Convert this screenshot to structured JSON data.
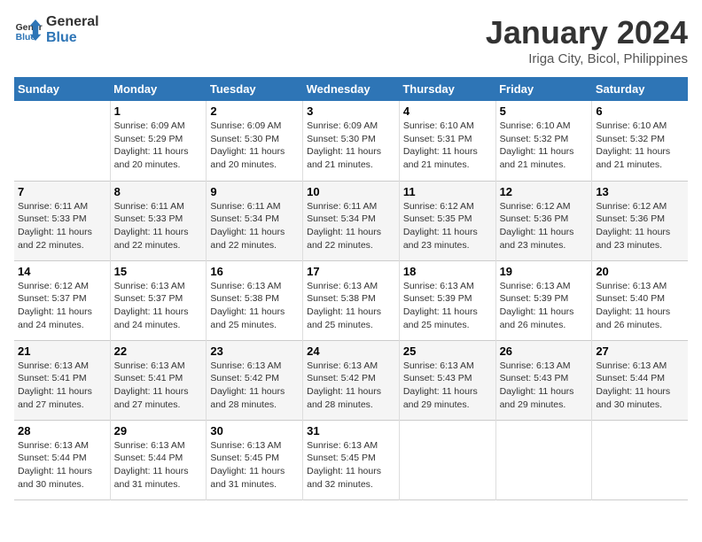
{
  "header": {
    "logo_line1": "General",
    "logo_line2": "Blue",
    "title": "January 2024",
    "subtitle": "Iriga City, Bicol, Philippines"
  },
  "columns": [
    "Sunday",
    "Monday",
    "Tuesday",
    "Wednesday",
    "Thursday",
    "Friday",
    "Saturday"
  ],
  "weeks": [
    [
      {
        "day": "",
        "text": ""
      },
      {
        "day": "1",
        "text": "Sunrise: 6:09 AM\nSunset: 5:29 PM\nDaylight: 11 hours\nand 20 minutes."
      },
      {
        "day": "2",
        "text": "Sunrise: 6:09 AM\nSunset: 5:30 PM\nDaylight: 11 hours\nand 20 minutes."
      },
      {
        "day": "3",
        "text": "Sunrise: 6:09 AM\nSunset: 5:30 PM\nDaylight: 11 hours\nand 21 minutes."
      },
      {
        "day": "4",
        "text": "Sunrise: 6:10 AM\nSunset: 5:31 PM\nDaylight: 11 hours\nand 21 minutes."
      },
      {
        "day": "5",
        "text": "Sunrise: 6:10 AM\nSunset: 5:32 PM\nDaylight: 11 hours\nand 21 minutes."
      },
      {
        "day": "6",
        "text": "Sunrise: 6:10 AM\nSunset: 5:32 PM\nDaylight: 11 hours\nand 21 minutes."
      }
    ],
    [
      {
        "day": "7",
        "text": "Sunrise: 6:11 AM\nSunset: 5:33 PM\nDaylight: 11 hours\nand 22 minutes."
      },
      {
        "day": "8",
        "text": "Sunrise: 6:11 AM\nSunset: 5:33 PM\nDaylight: 11 hours\nand 22 minutes."
      },
      {
        "day": "9",
        "text": "Sunrise: 6:11 AM\nSunset: 5:34 PM\nDaylight: 11 hours\nand 22 minutes."
      },
      {
        "day": "10",
        "text": "Sunrise: 6:11 AM\nSunset: 5:34 PM\nDaylight: 11 hours\nand 22 minutes."
      },
      {
        "day": "11",
        "text": "Sunrise: 6:12 AM\nSunset: 5:35 PM\nDaylight: 11 hours\nand 23 minutes."
      },
      {
        "day": "12",
        "text": "Sunrise: 6:12 AM\nSunset: 5:36 PM\nDaylight: 11 hours\nand 23 minutes."
      },
      {
        "day": "13",
        "text": "Sunrise: 6:12 AM\nSunset: 5:36 PM\nDaylight: 11 hours\nand 23 minutes."
      }
    ],
    [
      {
        "day": "14",
        "text": "Sunrise: 6:12 AM\nSunset: 5:37 PM\nDaylight: 11 hours\nand 24 minutes."
      },
      {
        "day": "15",
        "text": "Sunrise: 6:13 AM\nSunset: 5:37 PM\nDaylight: 11 hours\nand 24 minutes."
      },
      {
        "day": "16",
        "text": "Sunrise: 6:13 AM\nSunset: 5:38 PM\nDaylight: 11 hours\nand 25 minutes."
      },
      {
        "day": "17",
        "text": "Sunrise: 6:13 AM\nSunset: 5:38 PM\nDaylight: 11 hours\nand 25 minutes."
      },
      {
        "day": "18",
        "text": "Sunrise: 6:13 AM\nSunset: 5:39 PM\nDaylight: 11 hours\nand 25 minutes."
      },
      {
        "day": "19",
        "text": "Sunrise: 6:13 AM\nSunset: 5:39 PM\nDaylight: 11 hours\nand 26 minutes."
      },
      {
        "day": "20",
        "text": "Sunrise: 6:13 AM\nSunset: 5:40 PM\nDaylight: 11 hours\nand 26 minutes."
      }
    ],
    [
      {
        "day": "21",
        "text": "Sunrise: 6:13 AM\nSunset: 5:41 PM\nDaylight: 11 hours\nand 27 minutes."
      },
      {
        "day": "22",
        "text": "Sunrise: 6:13 AM\nSunset: 5:41 PM\nDaylight: 11 hours\nand 27 minutes."
      },
      {
        "day": "23",
        "text": "Sunrise: 6:13 AM\nSunset: 5:42 PM\nDaylight: 11 hours\nand 28 minutes."
      },
      {
        "day": "24",
        "text": "Sunrise: 6:13 AM\nSunset: 5:42 PM\nDaylight: 11 hours\nand 28 minutes."
      },
      {
        "day": "25",
        "text": "Sunrise: 6:13 AM\nSunset: 5:43 PM\nDaylight: 11 hours\nand 29 minutes."
      },
      {
        "day": "26",
        "text": "Sunrise: 6:13 AM\nSunset: 5:43 PM\nDaylight: 11 hours\nand 29 minutes."
      },
      {
        "day": "27",
        "text": "Sunrise: 6:13 AM\nSunset: 5:44 PM\nDaylight: 11 hours\nand 30 minutes."
      }
    ],
    [
      {
        "day": "28",
        "text": "Sunrise: 6:13 AM\nSunset: 5:44 PM\nDaylight: 11 hours\nand 30 minutes."
      },
      {
        "day": "29",
        "text": "Sunrise: 6:13 AM\nSunset: 5:44 PM\nDaylight: 11 hours\nand 31 minutes."
      },
      {
        "day": "30",
        "text": "Sunrise: 6:13 AM\nSunset: 5:45 PM\nDaylight: 11 hours\nand 31 minutes."
      },
      {
        "day": "31",
        "text": "Sunrise: 6:13 AM\nSunset: 5:45 PM\nDaylight: 11 hours\nand 32 minutes."
      },
      {
        "day": "",
        "text": ""
      },
      {
        "day": "",
        "text": ""
      },
      {
        "day": "",
        "text": ""
      }
    ]
  ]
}
